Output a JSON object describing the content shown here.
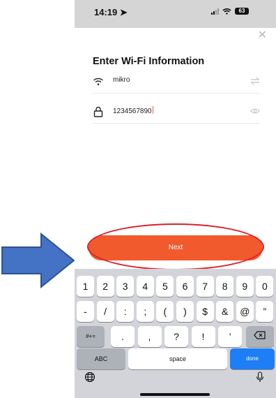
{
  "status_bar": {
    "time": "14:19",
    "battery": "63"
  },
  "dialog": {
    "title": "Enter Wi-Fi Information"
  },
  "wifi": {
    "ssid": "mikro",
    "password": "1234567890"
  },
  "actions": {
    "next_label": "Next"
  },
  "keyboard": {
    "row1": [
      "1",
      "2",
      "3",
      "4",
      "5",
      "6",
      "7",
      "8",
      "9",
      "0"
    ],
    "row2": [
      "-",
      "/",
      ":",
      ";",
      "(",
      ")",
      "$",
      "&",
      "@",
      "”"
    ],
    "row3": [
      ".",
      ",",
      "?",
      "!",
      "’"
    ],
    "symbol_toggle": "#+=",
    "abc": "ABC",
    "space": "space",
    "done": "done"
  },
  "annotations": {
    "ring_color": "#dc1f2c",
    "arrow_color": "#4472c4",
    "accent": "#f15a2c"
  }
}
